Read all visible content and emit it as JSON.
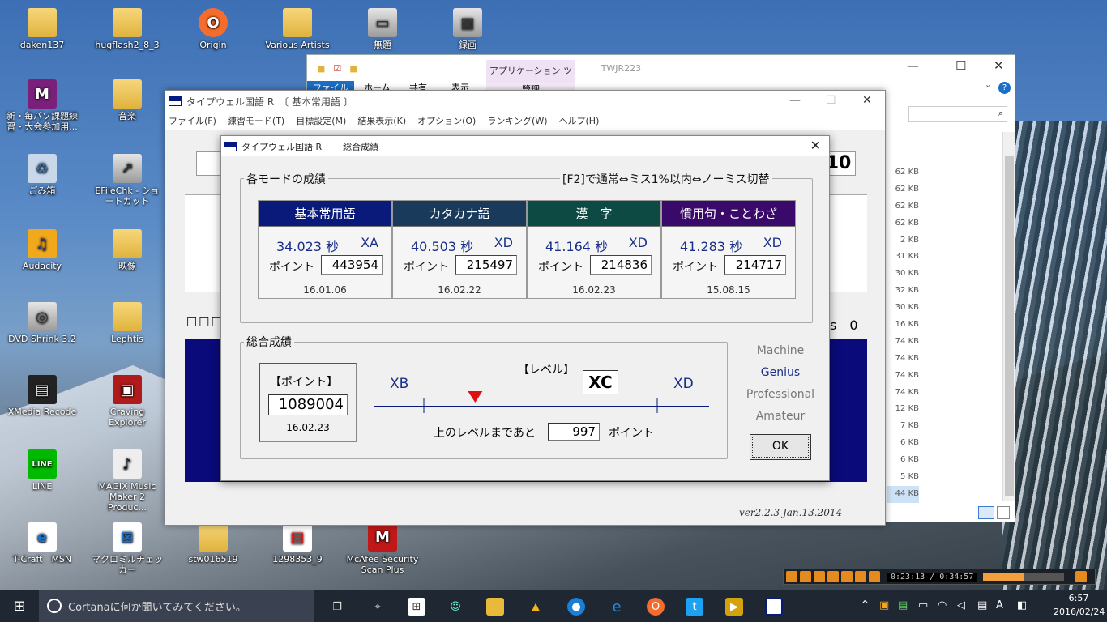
{
  "desktop": {
    "icons": [
      {
        "label": "daken137"
      },
      {
        "label": "hugflash2_8_3"
      },
      {
        "label": "Origin"
      },
      {
        "label": "Various Artists"
      },
      {
        "label": "無題"
      },
      {
        "label": "録画"
      },
      {
        "label": "新・毎パソ課題練習・大会参加用..."
      },
      {
        "label": "音楽"
      },
      {
        "label": "ごみ箱"
      },
      {
        "label": "EFileChk - ショートカット"
      },
      {
        "label": "Audacity"
      },
      {
        "label": "映像"
      },
      {
        "label": "DVD Shrink 3.2"
      },
      {
        "label": "Lephtis"
      },
      {
        "label": "XMedia Recode"
      },
      {
        "label": "Craving Explorer"
      },
      {
        "label": "LINE"
      },
      {
        "label": "MAGIX Music Maker 2 Produc..."
      },
      {
        "label": "T-Craft　MSN"
      },
      {
        "label": "マクロミルチェッカー"
      },
      {
        "label": "stw016519"
      },
      {
        "label": "1298353_9"
      },
      {
        "label": "McAfee Security Scan Plus"
      }
    ]
  },
  "explorer": {
    "title": "TWJR223",
    "context_tab": "アプリケーション ツール",
    "context_sub": "管理",
    "tabs": [
      "ファイル",
      "ホーム",
      "共有",
      "表示"
    ],
    "sizes": [
      "62 KB",
      "62 KB",
      "62 KB",
      "62 KB",
      "2 KB",
      "31 KB",
      "30 KB",
      "32 KB",
      "30 KB",
      "16 KB",
      "74 KB",
      "74 KB",
      "74 KB",
      "74 KB",
      "12 KB",
      "7 KB",
      "6 KB",
      "6 KB",
      "5 KB",
      "44 KB"
    ]
  },
  "mainwin": {
    "title": "タイプウェル国語 R　〔 基本常用語 〕",
    "menu": [
      "ファイル(F)",
      "練習モード(T)",
      "目標設定(M)",
      "結果表示(K)",
      "オプション(O)",
      "ランキング(W)",
      "ヘルプ(H)"
    ],
    "bg_fragment_1": "10",
    "bg_fragment_2": "s　0",
    "bg_fragment_3": "□□□",
    "version": "ver2.2.3  Jan.13.2014"
  },
  "dialog": {
    "title_app": "タイプウェル国語 R",
    "title_name": "総合成績",
    "modes_label": "各モードの成績",
    "toggle_hint": "[F2]で通常⇔ミス1%以内⇔ノーミス切替",
    "modes": [
      {
        "name": "基本常用語",
        "time": "34.023 秒",
        "grade": "XA",
        "point_label": "ポイント",
        "points": "443954",
        "date": "16.01.06",
        "color": "#0a1a7a"
      },
      {
        "name": "カタカナ語",
        "time": "40.503 秒",
        "grade": "XD",
        "point_label": "ポイント",
        "points": "215497",
        "date": "16.02.22",
        "color": "#1a3a5c"
      },
      {
        "name": "漢　字",
        "time": "41.164 秒",
        "grade": "XD",
        "point_label": "ポイント",
        "points": "214836",
        "date": "16.02.23",
        "color": "#0d4a44"
      },
      {
        "name": "慣用句・ことわざ",
        "time": "41.283 秒",
        "grade": "XD",
        "point_label": "ポイント",
        "points": "214717",
        "date": "15.08.15",
        "color": "#3a0a6a"
      }
    ],
    "total_label": "総合成績",
    "point_box_label": "【ポイント】",
    "total_points": "1089004",
    "total_date": "16.02.23",
    "level_label": "【レベル】",
    "level_left": "XB",
    "level_current": "XC",
    "level_right": "XD",
    "level_progress": 0.22,
    "remaining_prefix": "上のレベルまであと",
    "remaining": "997",
    "remaining_suffix": "ポイント",
    "ranks": [
      "Machine",
      "Genius",
      "Professional",
      "Amateur"
    ],
    "current_rank": "Genius",
    "ok_label": "OK"
  },
  "player": {
    "time": "0:23:13 / 0:34:57"
  },
  "taskbar": {
    "search_placeholder": "Cortanaに何か聞いてみてください。",
    "time": "6:57",
    "date": "2016/02/24",
    "ime": "A"
  }
}
